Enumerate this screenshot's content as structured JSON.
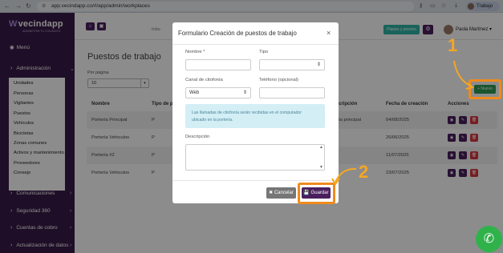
{
  "browser": {
    "url": "app.vecindapp.co/#/app/admin/workplaces",
    "profile": "Trabajo"
  },
  "sidebar": {
    "brand": "vecindapp",
    "brand_sub": "ADMINISTRA TU CONJUNTO",
    "menu_label": "Menú",
    "admin_label": "Administración",
    "sub_items": [
      "Unidades",
      "Personas",
      "Vigilantes",
      "Puestos",
      "Vehículos",
      "Bicicletas",
      "Zonas comunes",
      "Activos y mantenimiento",
      "Proveedores",
      "Consejo"
    ],
    "groups": [
      "Comunicaciones",
      "Seguridad 360",
      "Cuentas de cobro",
      "Actualización de datos"
    ]
  },
  "topbar": {
    "inbox": "Inbo",
    "plan_button": "Planes y precios",
    "user_name": "Paola Martínez"
  },
  "page": {
    "title": "Puestos de trabajo",
    "per_page_label": "Por página",
    "per_page_value": "10",
    "new_button": "+ Nuevo",
    "columns": {
      "name": "Nombre",
      "type": "Tipo de p",
      "description": "cripción",
      "created": "Fecha de creación",
      "actions": "Acciones"
    },
    "rows": [
      {
        "name": "Portería Principal",
        "type": "P",
        "description": "ía principal",
        "created": "04/08/2025"
      },
      {
        "name": "Portería Vehiculos",
        "type": "P",
        "description": "",
        "created": "26/06/2025"
      },
      {
        "name": "Portería #2",
        "type": "P",
        "description": "",
        "created": "11/07/2025"
      },
      {
        "name": "Portería Vehiculos",
        "type": "P",
        "description": "",
        "created": "23/07/2025"
      }
    ]
  },
  "modal": {
    "title": "Formulario Creación de puestos de trabajo",
    "close": "×",
    "name_label": "Nombre *",
    "name_value": "",
    "type_label": "Tipo",
    "type_value": "",
    "channel_label": "Canal de citofonía",
    "channel_value": "Web",
    "phone_label": "Teléfono (opcional)",
    "phone_value": "",
    "info_line1": "Las llamadas de citofonía serán recibidas en el computador",
    "info_line2": "ubicado en la portería.",
    "description_label": "Descripción",
    "cancel_button": "✖ Cancelar",
    "save_button": "💾 Guardar"
  },
  "annotations": {
    "step1": "1",
    "step2": "2",
    "highlight_color": "#f08a1c"
  }
}
